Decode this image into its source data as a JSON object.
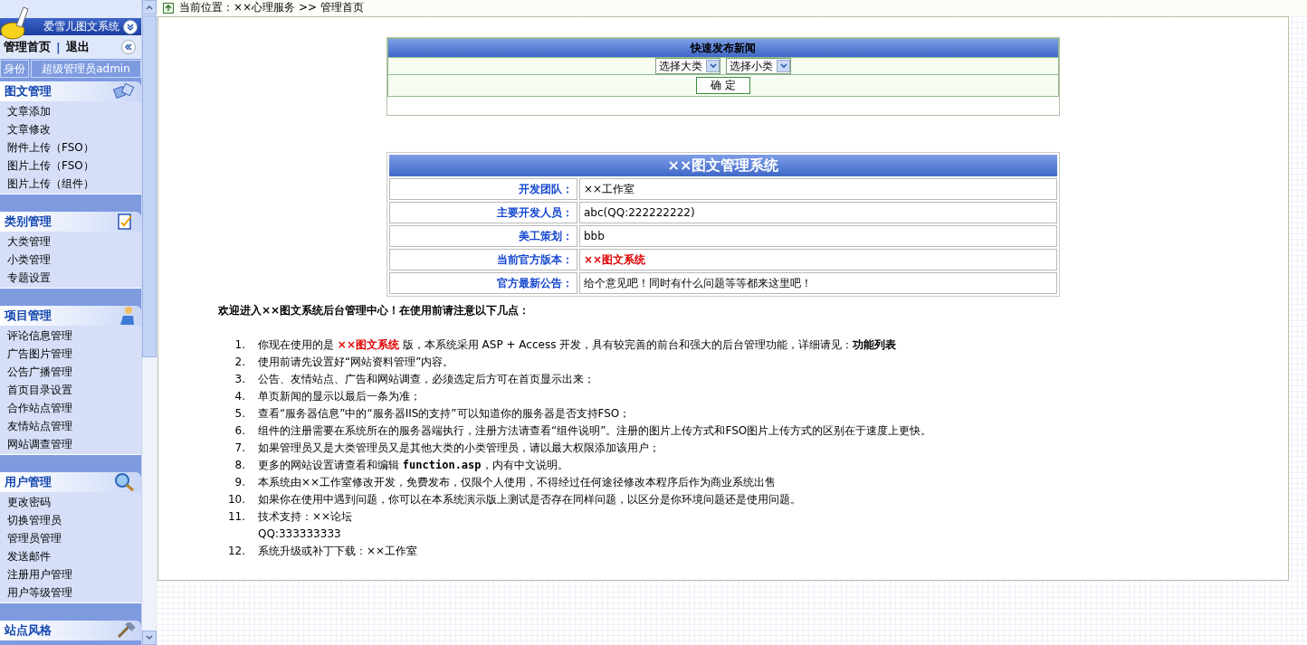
{
  "sidebar": {
    "logo_title": "爱雪儿图文系统",
    "links": [
      {
        "label": "管理首页"
      },
      {
        "label": "退出"
      }
    ],
    "separator": "|",
    "identity_label": "身份",
    "identity_value": "超级管理员admin",
    "sections": [
      {
        "title": "图文管理",
        "items": [
          "文章添加",
          "文章修改",
          "附件上传（FSO）",
          "图片上传（FSO）",
          "图片上传（组件）"
        ]
      },
      {
        "title": "类别管理",
        "items": [
          "大类管理",
          "小类管理",
          "专题设置"
        ]
      },
      {
        "title": "项目管理",
        "items": [
          "评论信息管理",
          "广告图片管理",
          "公告广播管理",
          "首页目录设置",
          "合作站点管理",
          "友情站点管理",
          "网站调查管理"
        ]
      },
      {
        "title": "用户管理",
        "items": [
          "更改密码",
          "切换管理员",
          "管理员管理",
          "发送邮件",
          "注册用户管理",
          "用户等级管理"
        ]
      },
      {
        "title": "站点风格"
      }
    ]
  },
  "breadcrumb": "当前位置：××心理服务 >> 管理首页",
  "quick_publish": {
    "title": "快速发布新闻",
    "selects": [
      {
        "value": "选择大类"
      },
      {
        "value": "选择小类"
      }
    ],
    "button": "确 定"
  },
  "info_table": {
    "title": "××图文管理系统",
    "rows": [
      {
        "label": "开发团队：",
        "value": "××工作室",
        "highlighted": false
      },
      {
        "label": "主要开发人员：",
        "value": "abc(QQ:222222222)",
        "highlighted": false
      },
      {
        "label": "美工策划：",
        "value": "bbb",
        "highlighted": false
      },
      {
        "label": "当前官方版本：",
        "value": "××图文系统",
        "highlighted": true
      },
      {
        "label": "官方最新公告：",
        "value": "给个意见吧！同时有什么问题等等都来这里吧！",
        "highlighted": false
      }
    ]
  },
  "welcome": {
    "heading": "欢迎进入××图文系统后台管理中心！在使用前请注意以下几点：",
    "items": [
      {
        "number": "1.",
        "parts": [
          {
            "kind": "plain",
            "text": "你现在使用的是 "
          },
          {
            "kind": "red",
            "text": "××图文系统"
          },
          {
            "kind": "plain",
            "text": " 版，本系统采用 ASP + Access 开发，具有较完善的前台和强大的后台管理功能，详细请见："
          },
          {
            "kind": "bold",
            "text": "功能列表"
          }
        ]
      },
      {
        "number": "2.",
        "parts": [
          {
            "kind": "plain",
            "text": "使用前请先设置好“网站资料管理”内容。"
          }
        ]
      },
      {
        "number": "3.",
        "parts": [
          {
            "kind": "plain",
            "text": "公告、友情站点、广告和网站调查，必须选定后方可在首页显示出来；"
          }
        ]
      },
      {
        "number": "4.",
        "parts": [
          {
            "kind": "plain",
            "text": "单页新闻的显示以最后一条为准；"
          }
        ]
      },
      {
        "number": "5.",
        "parts": [
          {
            "kind": "plain",
            "text": "查看“服务器信息”中的“服务器IIS的支持”可以知道你的服务器是否支持FSO；"
          }
        ]
      },
      {
        "number": "6.",
        "parts": [
          {
            "kind": "plain",
            "text": "组件的注册需要在系统所在的服务器端执行，注册方法请查看“组件说明”。注册的图片上传方式和FSO图片上传方式的区别在于速度上更快。"
          }
        ]
      },
      {
        "number": "7.",
        "parts": [
          {
            "kind": "plain",
            "text": "如果管理员又是大类管理员又是其他大类的小类管理员，请以最大权限添加该用户；"
          }
        ]
      },
      {
        "number": "8.",
        "parts": [
          {
            "kind": "plain",
            "text": "更多的网站设置请查看和编辑 "
          },
          {
            "kind": "code",
            "text": "function.asp"
          },
          {
            "kind": "plain",
            "text": "，内有中文说明。"
          }
        ]
      },
      {
        "number": "9.",
        "parts": [
          {
            "kind": "plain",
            "text": "本系统由××工作室修改开发，免费发布，仅限个人使用，不得经过任何途径修改本程序后作为商业系统出售"
          }
        ]
      },
      {
        "number": "10.",
        "parts": [
          {
            "kind": "plain",
            "text": "如果你在使用中遇到问题，你可以在本系统演示版上测试是否存在同样问题，以区分是你环境问题还是使用问题。"
          }
        ]
      },
      {
        "number": "11.",
        "parts": [
          {
            "kind": "plain",
            "text": "技术支持：××论坛"
          }
        ],
        "note": "QQ:333333333"
      },
      {
        "number": "12.",
        "parts": [
          {
            "kind": "plain",
            "text": "系统升级或补丁下载：××工作室"
          }
        ]
      }
    ]
  }
}
